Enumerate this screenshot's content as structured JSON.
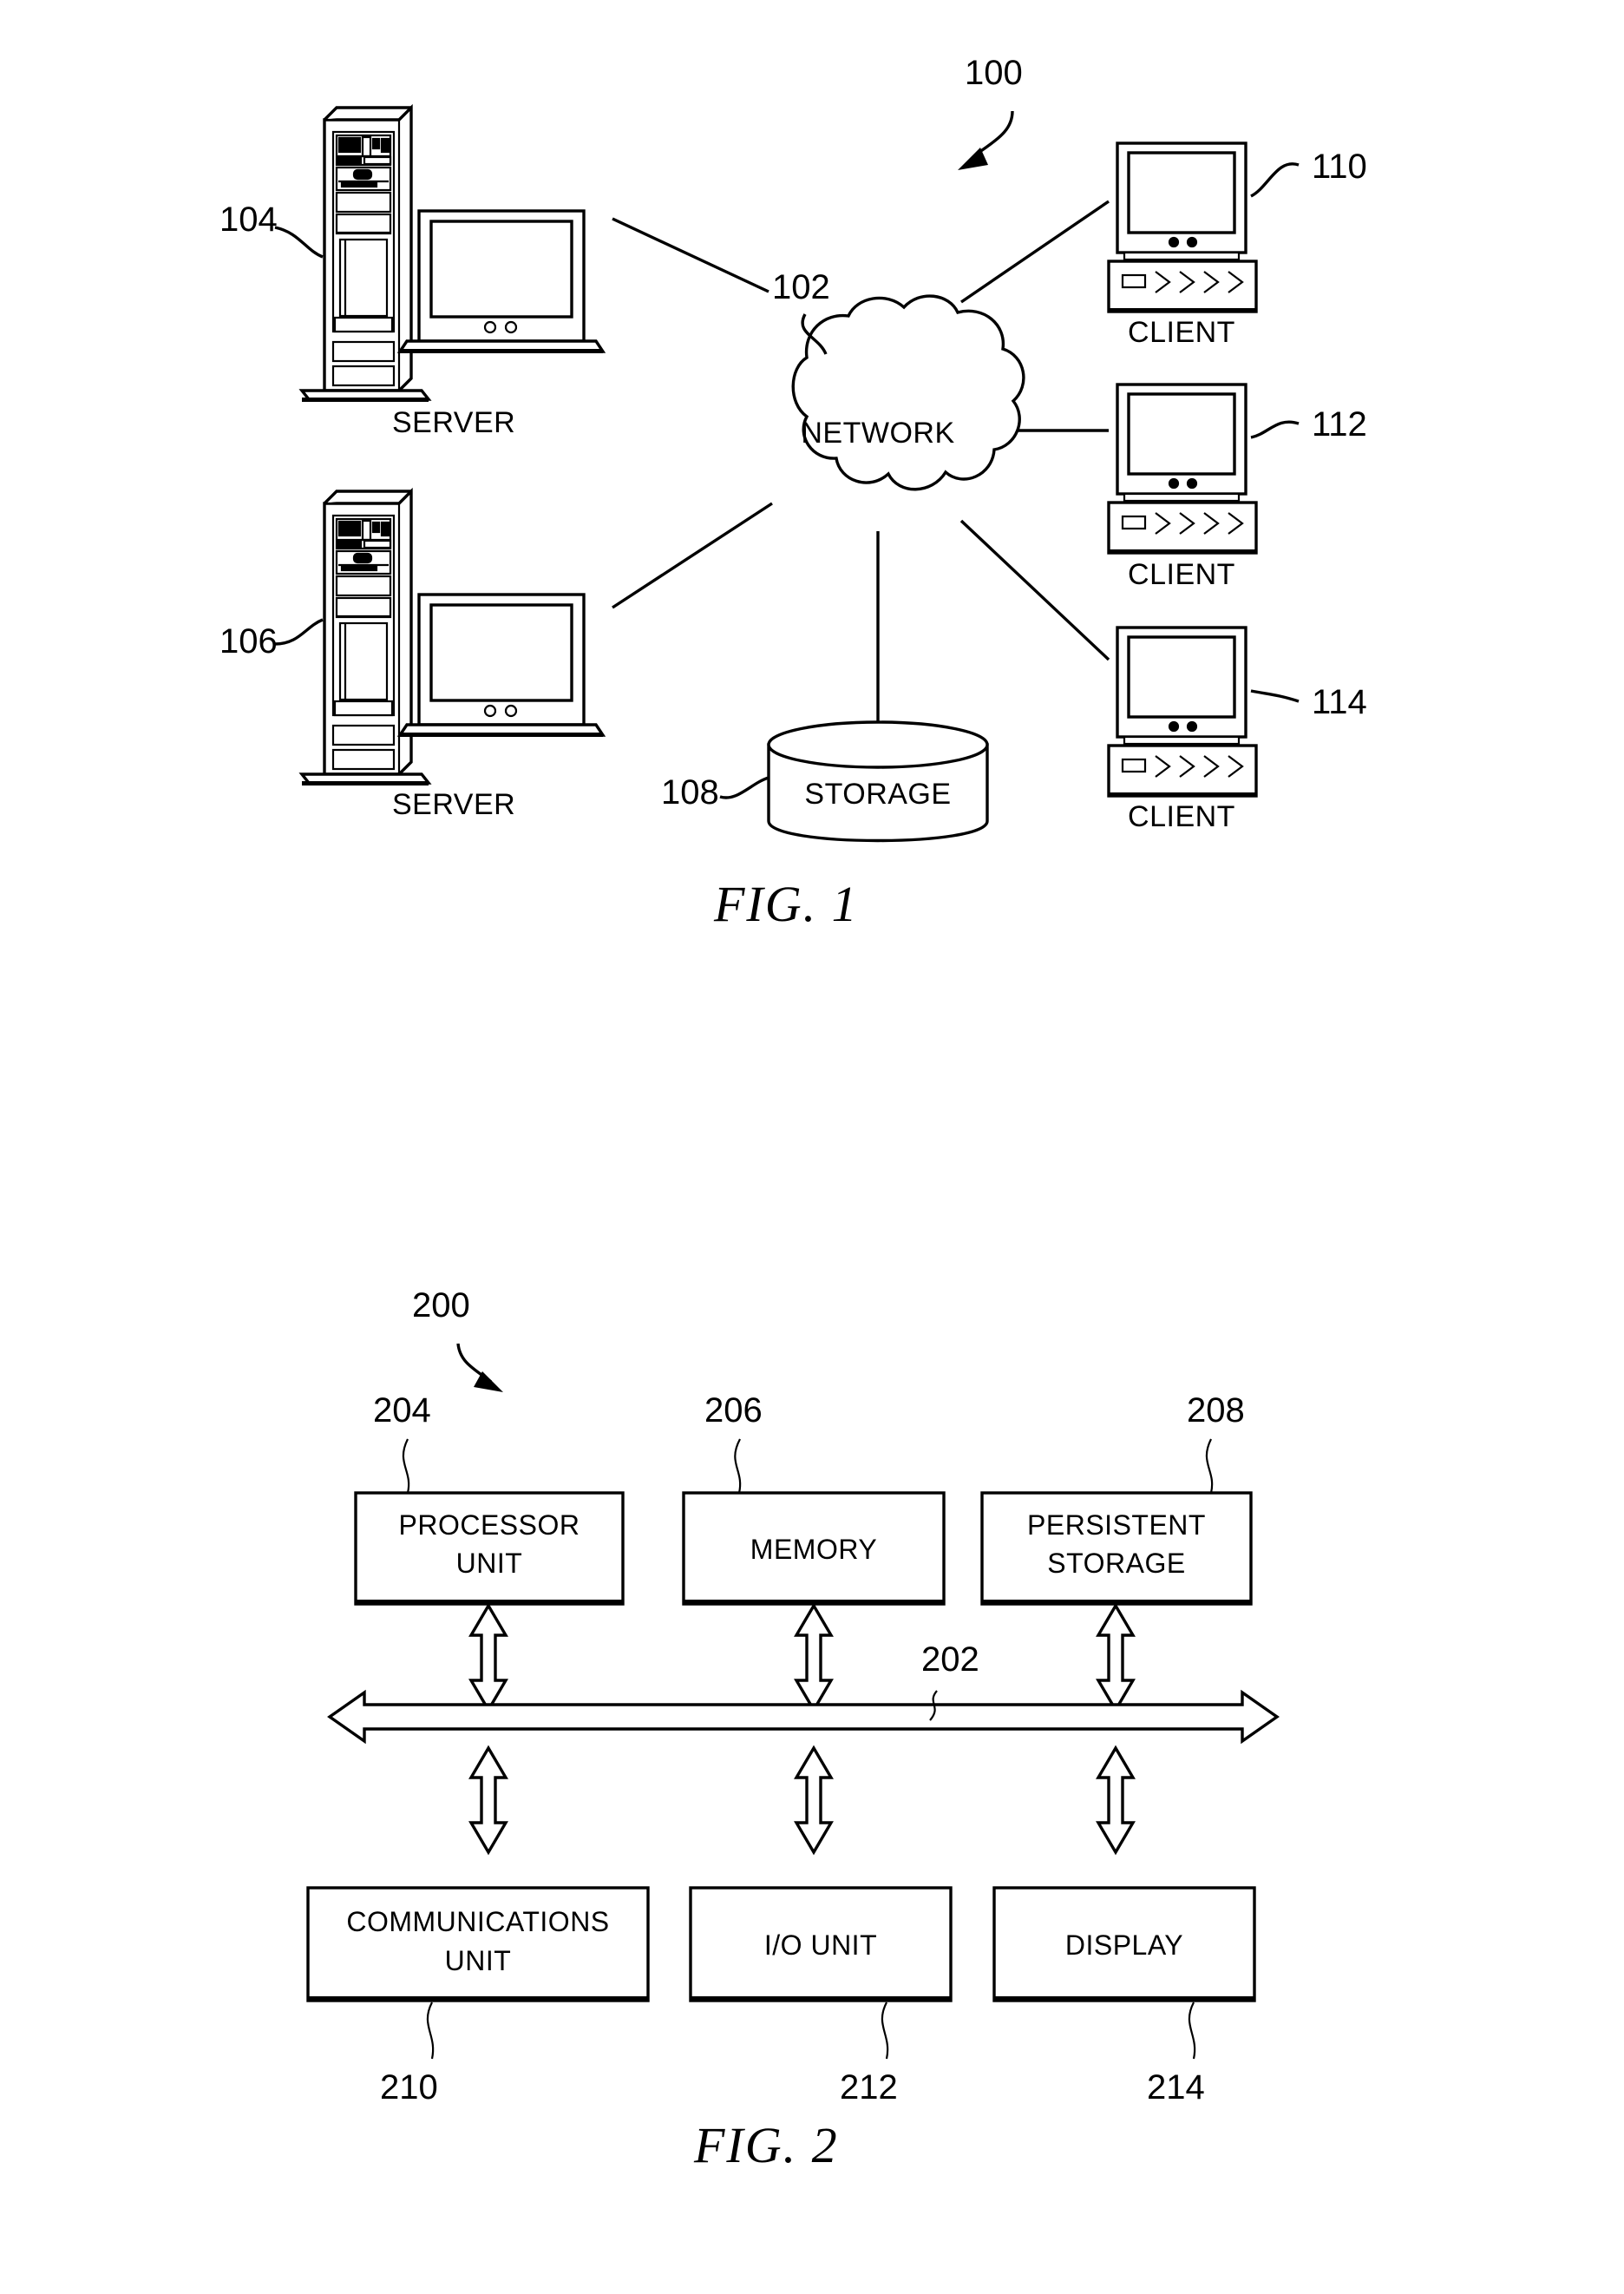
{
  "document": {
    "type": "patent-figure-sheet",
    "background_color": "#ffffff",
    "ink_color": "#000000"
  },
  "figure1": {
    "caption": "FIG. 1",
    "system_ref": "100",
    "network": {
      "ref": "102",
      "label": "NETWORK"
    },
    "storage": {
      "ref": "108",
      "label": "STORAGE"
    },
    "servers": [
      {
        "ref": "104",
        "label": "SERVER"
      },
      {
        "ref": "106",
        "label": "SERVER"
      }
    ],
    "clients": [
      {
        "ref": "110",
        "label": "CLIENT"
      },
      {
        "ref": "112",
        "label": "CLIENT"
      },
      {
        "ref": "114",
        "label": "CLIENT"
      }
    ]
  },
  "figure2": {
    "caption": "FIG. 2",
    "system_ref": "200",
    "bus": {
      "ref": "202",
      "label": ""
    },
    "top_row": [
      {
        "ref": "204",
        "label_line1": "PROCESSOR",
        "label_line2": "UNIT"
      },
      {
        "ref": "206",
        "label_line1": "MEMORY",
        "label_line2": ""
      },
      {
        "ref": "208",
        "label_line1": "PERSISTENT",
        "label_line2": "STORAGE"
      }
    ],
    "bottom_row": [
      {
        "ref": "210",
        "label_line1": "COMMUNICATIONS",
        "label_line2": "UNIT"
      },
      {
        "ref": "212",
        "label_line1": "I/O UNIT",
        "label_line2": ""
      },
      {
        "ref": "214",
        "label_line1": "DISPLAY",
        "label_line2": ""
      }
    ]
  }
}
